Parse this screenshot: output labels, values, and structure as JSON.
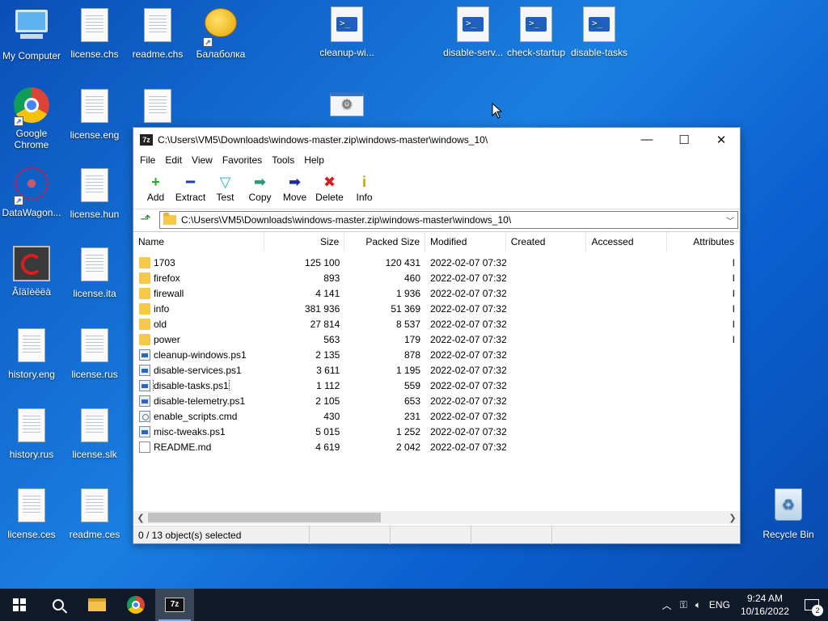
{
  "desktop": {
    "icons": [
      {
        "label": "My Computer",
        "icon": "computer-icon"
      },
      {
        "label": "license.chs",
        "icon": "document-icon"
      },
      {
        "label": "readme.chs",
        "icon": "document-icon"
      },
      {
        "label": "Балаболка",
        "icon": "balabolka-icon"
      },
      {
        "label": "cleanup-wi...",
        "icon": "powershell-script-icon"
      },
      {
        "label": "disable-serv...",
        "icon": "powershell-script-icon"
      },
      {
        "label": "check-startup",
        "icon": "powershell-script-icon"
      },
      {
        "label": "disable-tasks",
        "icon": "powershell-script-icon"
      },
      {
        "label": "Google Chrome",
        "icon": "chrome-icon"
      },
      {
        "label": "license.eng",
        "icon": "document-icon"
      },
      {
        "label": "",
        "icon": "document-icon"
      },
      {
        "label": "",
        "icon": "settings-window-icon"
      },
      {
        "label": "DataWagon...",
        "icon": "datawagon-icon"
      },
      {
        "label": "license.hun",
        "icon": "document-icon"
      },
      {
        "label": "Âîäîèëëà",
        "icon": "app-icon"
      },
      {
        "label": "license.ita",
        "icon": "document-icon"
      },
      {
        "label": "history.eng",
        "icon": "document-icon"
      },
      {
        "label": "license.rus",
        "icon": "document-icon"
      },
      {
        "label": "history.rus",
        "icon": "document-icon"
      },
      {
        "label": "license.slk",
        "icon": "document-icon"
      },
      {
        "label": "license.ces",
        "icon": "document-icon"
      },
      {
        "label": "readme.ces",
        "icon": "document-icon"
      },
      {
        "label": "Recycle Bin",
        "icon": "recycle-bin-icon"
      }
    ]
  },
  "window": {
    "app_icon_text": "7z",
    "title": "C:\\Users\\VM5\\Downloads\\windows-master.zip\\windows-master\\windows_10\\",
    "controls": {
      "minimize": "—",
      "maximize": "☐",
      "close": "✕"
    },
    "menu": [
      "File",
      "Edit",
      "View",
      "Favorites",
      "Tools",
      "Help"
    ],
    "toolbar": [
      {
        "label": "Add",
        "glyph": "+",
        "color": "#2aa52a",
        "icon": "add-icon"
      },
      {
        "label": "Extract",
        "glyph": "━",
        "color": "#1f3fb0",
        "icon": "extract-icon"
      },
      {
        "label": "Test",
        "glyph": "▽",
        "color": "#2ab0c0",
        "icon": "test-icon"
      },
      {
        "label": "Copy",
        "glyph": "➡",
        "color": "#2a9a7a",
        "icon": "copy-icon"
      },
      {
        "label": "Move",
        "glyph": "➡",
        "color": "#1f2fa0",
        "icon": "move-icon"
      },
      {
        "label": "Delete",
        "glyph": "✖",
        "color": "#d02020",
        "icon": "delete-icon"
      },
      {
        "label": "Info",
        "glyph": "i",
        "color": "#c8a000",
        "icon": "info-icon"
      }
    ],
    "address": "C:\\Users\\VM5\\Downloads\\windows-master.zip\\windows-master\\windows_10\\",
    "columns": [
      "Name",
      "Size",
      "Packed Size",
      "Modified",
      "Created",
      "Accessed",
      "Attributes"
    ],
    "files": [
      {
        "name": "1703",
        "type": "folder",
        "size": "125 100",
        "packed": "120 431",
        "modified": "2022-02-07 07:32",
        "attr": "I"
      },
      {
        "name": "firefox",
        "type": "folder",
        "size": "893",
        "packed": "460",
        "modified": "2022-02-07 07:32",
        "attr": "I"
      },
      {
        "name": "firewall",
        "type": "folder",
        "size": "4 141",
        "packed": "1 936",
        "modified": "2022-02-07 07:32",
        "attr": "I"
      },
      {
        "name": "info",
        "type": "folder",
        "size": "381 936",
        "packed": "51 369",
        "modified": "2022-02-07 07:32",
        "attr": "I"
      },
      {
        "name": "old",
        "type": "folder",
        "size": "27 814",
        "packed": "8 537",
        "modified": "2022-02-07 07:32",
        "attr": "I"
      },
      {
        "name": "power",
        "type": "folder",
        "size": "563",
        "packed": "179",
        "modified": "2022-02-07 07:32",
        "attr": "I"
      },
      {
        "name": "cleanup-windows.ps1",
        "type": "ps1",
        "size": "2 135",
        "packed": "878",
        "modified": "2022-02-07 07:32",
        "attr": ""
      },
      {
        "name": "disable-services.ps1",
        "type": "ps1",
        "size": "3 611",
        "packed": "1 195",
        "modified": "2022-02-07 07:32",
        "attr": ""
      },
      {
        "name": "disable-tasks.ps1",
        "type": "ps1",
        "size": "1 112",
        "packed": "559",
        "modified": "2022-02-07 07:32",
        "attr": "",
        "focused": true
      },
      {
        "name": "disable-telemetry.ps1",
        "type": "ps1",
        "size": "2 105",
        "packed": "653",
        "modified": "2022-02-07 07:32",
        "attr": ""
      },
      {
        "name": "enable_scripts.cmd",
        "type": "cmd",
        "size": "430",
        "packed": "231",
        "modified": "2022-02-07 07:32",
        "attr": ""
      },
      {
        "name": "misc-tweaks.ps1",
        "type": "ps1",
        "size": "5 015",
        "packed": "1 252",
        "modified": "2022-02-07 07:32",
        "attr": ""
      },
      {
        "name": "README.md",
        "type": "md",
        "size": "4 619",
        "packed": "2 042",
        "modified": "2022-02-07 07:32",
        "attr": ""
      }
    ],
    "status": "0 / 13 object(s) selected"
  },
  "taskbar": {
    "language": "ENG",
    "time": "9:24 AM",
    "date": "10/16/2022",
    "notification_count": "2"
  }
}
